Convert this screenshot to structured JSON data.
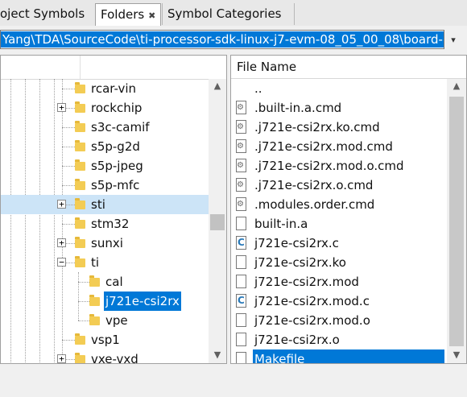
{
  "tabs": [
    {
      "label": "oject Symbols"
    },
    {
      "label": "Folders",
      "close_label": "✖"
    },
    {
      "label": "Symbol Categories"
    }
  ],
  "path": {
    "value": "Yang\\TDA\\SourceCode\\ti-processor-sdk-linux-j7-evm-08_05_00_08\\board-",
    "dropdown_glyph": "▾"
  },
  "tree": {
    "items": [
      {
        "label": "rcar-vin",
        "expander": ""
      },
      {
        "label": "rockchip",
        "expander": "+"
      },
      {
        "label": "s3c-camif",
        "expander": ""
      },
      {
        "label": "s5p-g2d",
        "expander": ""
      },
      {
        "label": "s5p-jpeg",
        "expander": ""
      },
      {
        "label": "s5p-mfc",
        "expander": ""
      },
      {
        "label": "sti",
        "expander": "+"
      },
      {
        "label": "stm32",
        "expander": ""
      },
      {
        "label": "sunxi",
        "expander": "+"
      },
      {
        "label": "ti",
        "expander": "−"
      },
      {
        "label": "cal",
        "expander": ""
      },
      {
        "label": "j721e-csi2rx",
        "expander": ""
      },
      {
        "label": "vpe",
        "expander": ""
      },
      {
        "label": "vsp1",
        "expander": ""
      },
      {
        "label": "vxe-vxd",
        "expander": "+"
      }
    ],
    "hover_item": "sti",
    "selected_item": "j721e-csi2rx",
    "scroll_up": "▲",
    "scroll_down": "▼"
  },
  "files": {
    "header": "File Name",
    "items": [
      {
        "name": "..",
        "icon": "up-icon"
      },
      {
        "name": ".built-in.a.cmd",
        "icon": "cmd-file-icon"
      },
      {
        "name": ".j721e-csi2rx.ko.cmd",
        "icon": "cmd-file-icon"
      },
      {
        "name": ".j721e-csi2rx.mod.cmd",
        "icon": "cmd-file-icon"
      },
      {
        "name": ".j721e-csi2rx.mod.o.cmd",
        "icon": "cmd-file-icon"
      },
      {
        "name": ".j721e-csi2rx.o.cmd",
        "icon": "cmd-file-icon"
      },
      {
        "name": ".modules.order.cmd",
        "icon": "cmd-file-icon"
      },
      {
        "name": "built-in.a",
        "icon": "file-icon"
      },
      {
        "name": "j721e-csi2rx.c",
        "icon": "c-source-file-icon"
      },
      {
        "name": "j721e-csi2rx.ko",
        "icon": "file-icon"
      },
      {
        "name": "j721e-csi2rx.mod",
        "icon": "file-icon"
      },
      {
        "name": "j721e-csi2rx.mod.c",
        "icon": "c-source-file-icon"
      },
      {
        "name": "j721e-csi2rx.mod.o",
        "icon": "file-icon"
      },
      {
        "name": "j721e-csi2rx.o",
        "icon": "file-icon"
      },
      {
        "name": "Makefile",
        "icon": "file-icon"
      }
    ],
    "selected_item": "Makefile",
    "scroll_up": "▲",
    "scroll_down": "▼"
  },
  "colors": {
    "selection": "#0078d7",
    "hover_row": "#cce4f7",
    "folder": "#f3cc54"
  }
}
